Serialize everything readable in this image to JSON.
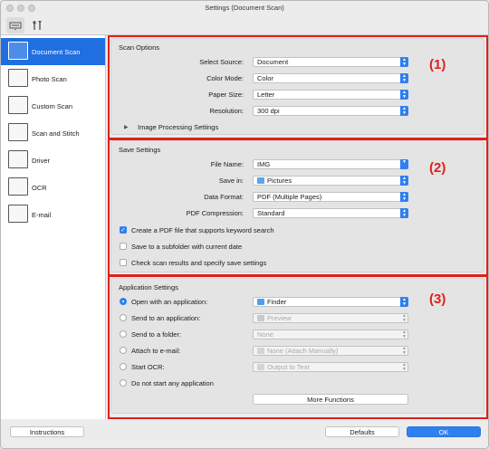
{
  "window": {
    "title": "Settings (Document Scan)"
  },
  "toolbar": {
    "tabs": [
      {
        "name": "scanner-settings-tab-icon"
      },
      {
        "name": "general-settings-tab-icon"
      }
    ]
  },
  "sidebar": {
    "items": [
      {
        "label": "Document Scan",
        "icon": "document-scan-icon"
      },
      {
        "label": "Photo Scan",
        "icon": "photo-scan-icon"
      },
      {
        "label": "Custom Scan",
        "icon": "custom-scan-icon"
      },
      {
        "label": "Scan and Stitch",
        "icon": "scan-and-stitch-icon"
      },
      {
        "label": "Driver",
        "icon": "driver-icon"
      },
      {
        "label": "OCR",
        "icon": "ocr-icon"
      },
      {
        "label": "E-mail",
        "icon": "email-icon"
      }
    ]
  },
  "scan_options": {
    "title": "Scan Options",
    "select_source_label": "Select Source:",
    "select_source_value": "Document",
    "color_mode_label": "Color Mode:",
    "color_mode_value": "Color",
    "paper_size_label": "Paper Size:",
    "paper_size_value": "Letter",
    "resolution_label": "Resolution:",
    "resolution_value": "300 dpi",
    "image_processing_label": "Image Processing Settings"
  },
  "save_settings": {
    "title": "Save Settings",
    "file_name_label": "File Name:",
    "file_name_value": "IMG",
    "save_in_label": "Save in:",
    "save_in_value": "Pictures",
    "data_format_label": "Data Format:",
    "data_format_value": "PDF (Multiple Pages)",
    "pdf_compression_label": "PDF Compression:",
    "pdf_compression_value": "Standard",
    "keyword_search_label": "Create a PDF file that supports keyword search",
    "subfolder_label": "Save to a subfolder with current date",
    "check_results_label": "Check scan results and specify save settings"
  },
  "application_settings": {
    "title": "Application Settings",
    "open_app_label": "Open with an application:",
    "open_app_value": "Finder",
    "send_app_label": "Send to an application:",
    "send_app_value": "Preview",
    "send_folder_label": "Send to a folder:",
    "send_folder_value": "None",
    "attach_email_label": "Attach to e-mail:",
    "attach_email_value": "None (Attach Manually)",
    "start_ocr_label": "Start OCR:",
    "start_ocr_value": "Output to Text",
    "no_app_label": "Do not start any application",
    "more_functions_label": "More Functions"
  },
  "annotations": {
    "label1": "(1)",
    "label2": "(2)",
    "label3": "(3)"
  },
  "footer": {
    "instructions_label": "Instructions",
    "defaults_label": "Defaults",
    "ok_label": "OK"
  },
  "colors": {
    "accent": "#2f7ff0",
    "selected_nav": "#1f6fe0",
    "callout_red": "#e0201b"
  }
}
